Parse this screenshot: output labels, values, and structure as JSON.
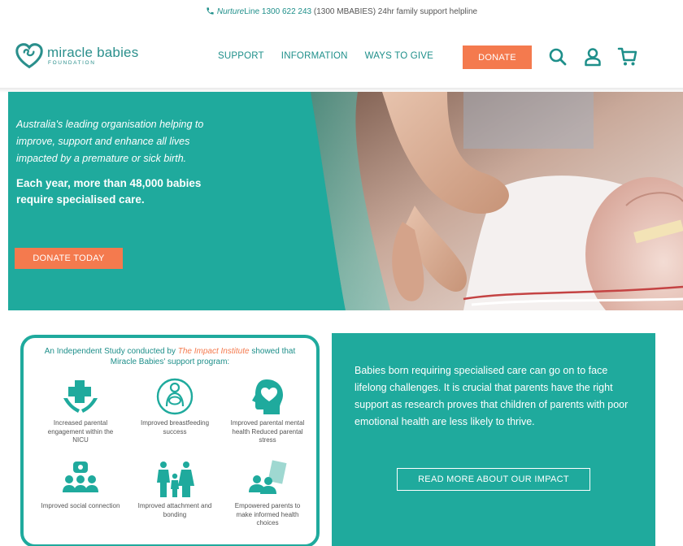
{
  "helpline": {
    "brand": "Nurture",
    "brand_suffix": "Line 1300 622 243",
    "rest": "(1300 MBABIES) 24hr family support helpline"
  },
  "logo": {
    "main": "miracle babies",
    "sub": "FOUNDATION"
  },
  "nav": {
    "items": [
      {
        "label": "SUPPORT"
      },
      {
        "label": "INFORMATION"
      },
      {
        "label": "WAYS TO GIVE"
      }
    ],
    "donate_label": "DONATE"
  },
  "header_icons": [
    "search-icon",
    "user-icon",
    "cart-icon"
  ],
  "hero": {
    "intro": "Australia's leading organisation helping to improve, support and enhance all lives impacted by a premature or sick birth.",
    "bold": "Each year, more than 48,000 babies require specialised care.",
    "button_label": "DONATE TODAY"
  },
  "study": {
    "title_before": "An Independent Study conducted by ",
    "title_highlight": "The Impact Institute",
    "title_after": " showed that Miracle Babies' support program:",
    "benefits": [
      {
        "icon": "medical-cross-hands-icon",
        "label": "Increased parental engagement within the NICU"
      },
      {
        "icon": "breastfeeding-icon",
        "label": "Improved breastfeeding success"
      },
      {
        "icon": "head-heart-icon",
        "label": "Improved parental mental health Reduced parental stress"
      },
      {
        "icon": "social-group-icon",
        "label": "Improved social connection"
      },
      {
        "icon": "family-icon",
        "label": "Improved attachment and bonding"
      },
      {
        "icon": "parents-booklet-icon",
        "label": "Empowered parents to make informed health choices"
      }
    ]
  },
  "impact": {
    "text": "Babies born requiring specialised care can go on to face lifelong challenges. It is crucial that parents have the right support as research proves that children of parents with poor emotional health are less likely to thrive.",
    "button_label": "READ MORE ABOUT OUR IMPACT"
  },
  "colors": {
    "teal": "#1faa9d",
    "teal_text": "#1e8f8a",
    "orange": "#f47a4e"
  }
}
